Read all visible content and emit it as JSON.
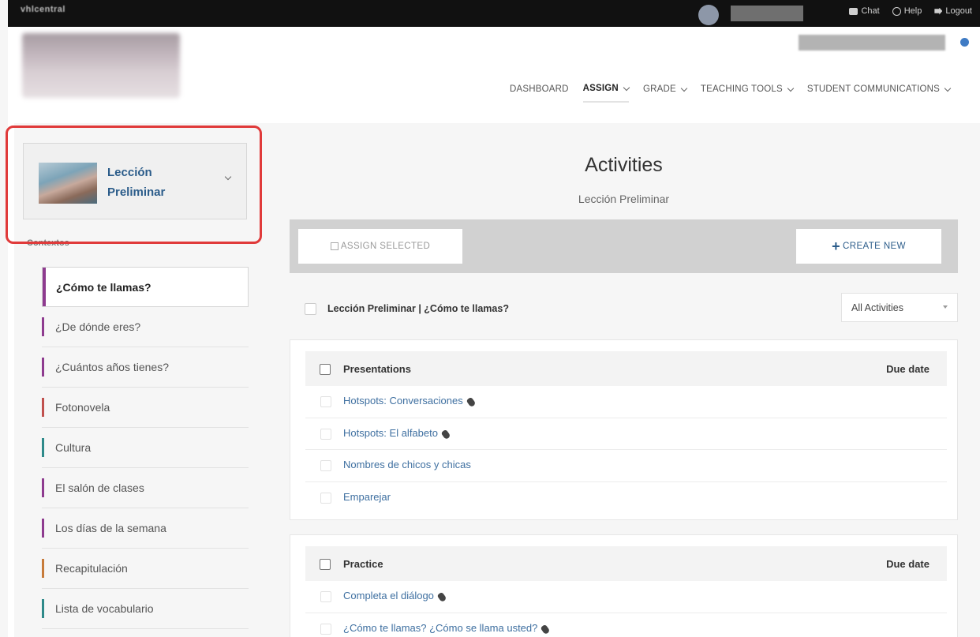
{
  "topbar": {
    "brand": "vhlcentral",
    "links": [
      {
        "label": "Chat",
        "icon": "chat-icon"
      },
      {
        "label": "Help",
        "icon": "help-icon"
      },
      {
        "label": "Logout",
        "icon": "logout-icon"
      }
    ]
  },
  "nav": {
    "items": [
      {
        "label": "DASHBOARD",
        "dropdown": false
      },
      {
        "label": "ASSIGN",
        "dropdown": true,
        "active": true
      },
      {
        "label": "GRADE",
        "dropdown": true
      },
      {
        "label": "TEACHING TOOLS",
        "dropdown": true
      },
      {
        "label": "STUDENT COMMUNICATIONS",
        "dropdown": true
      }
    ]
  },
  "sidebar": {
    "lesson": {
      "title": "Lección Preliminar"
    },
    "section_label": "Contextos",
    "topics": [
      {
        "label": "¿Cómo te llamas?",
        "color": "#8e3b8f",
        "active": true
      },
      {
        "label": "¿De dónde eres?",
        "color": "#8e3b8f"
      },
      {
        "label": "¿Cuántos años tienes?",
        "color": "#8e3b8f"
      },
      {
        "label": "Fotonovela",
        "color": "#c0504d"
      },
      {
        "label": "Cultura",
        "color": "#2e8a8a"
      },
      {
        "label": "El salón de clases",
        "color": "#8e3b8f"
      },
      {
        "label": "Los días de la semana",
        "color": "#8e3b8f"
      },
      {
        "label": "Recapitulación",
        "color": "#c77b3a"
      },
      {
        "label": "Lista de vocabulario",
        "color": "#2e8a8a"
      }
    ]
  },
  "main": {
    "title": "Activities",
    "subtitle": "Lección Preliminar",
    "toolbar": {
      "assign_label": "ASSIGN SELECTED",
      "create_label": "CREATE NEW"
    },
    "filter": {
      "title": "Lección Preliminar | ¿Cómo te llamas?",
      "select_value": "All Activities"
    },
    "sections": [
      {
        "title": "Presentations",
        "due_label": "Due date",
        "activities": [
          {
            "label": "Hotspots: Conversaciones",
            "interactive": true
          },
          {
            "label": "Hotspots: El alfabeto",
            "interactive": true
          },
          {
            "label": "Nombres de chicos y chicas",
            "interactive": false
          },
          {
            "label": "Emparejar",
            "interactive": false
          }
        ]
      },
      {
        "title": "Practice",
        "due_label": "Due date",
        "activities": [
          {
            "label": "Completa el diálogo",
            "interactive": true
          },
          {
            "label": "¿Cómo te llamas? ¿Cómo se llama usted?",
            "interactive": true
          }
        ]
      }
    ]
  },
  "colors": {
    "accent": "#2b5c8a",
    "highlight": "#e03a3a",
    "topbar": "#111111"
  }
}
